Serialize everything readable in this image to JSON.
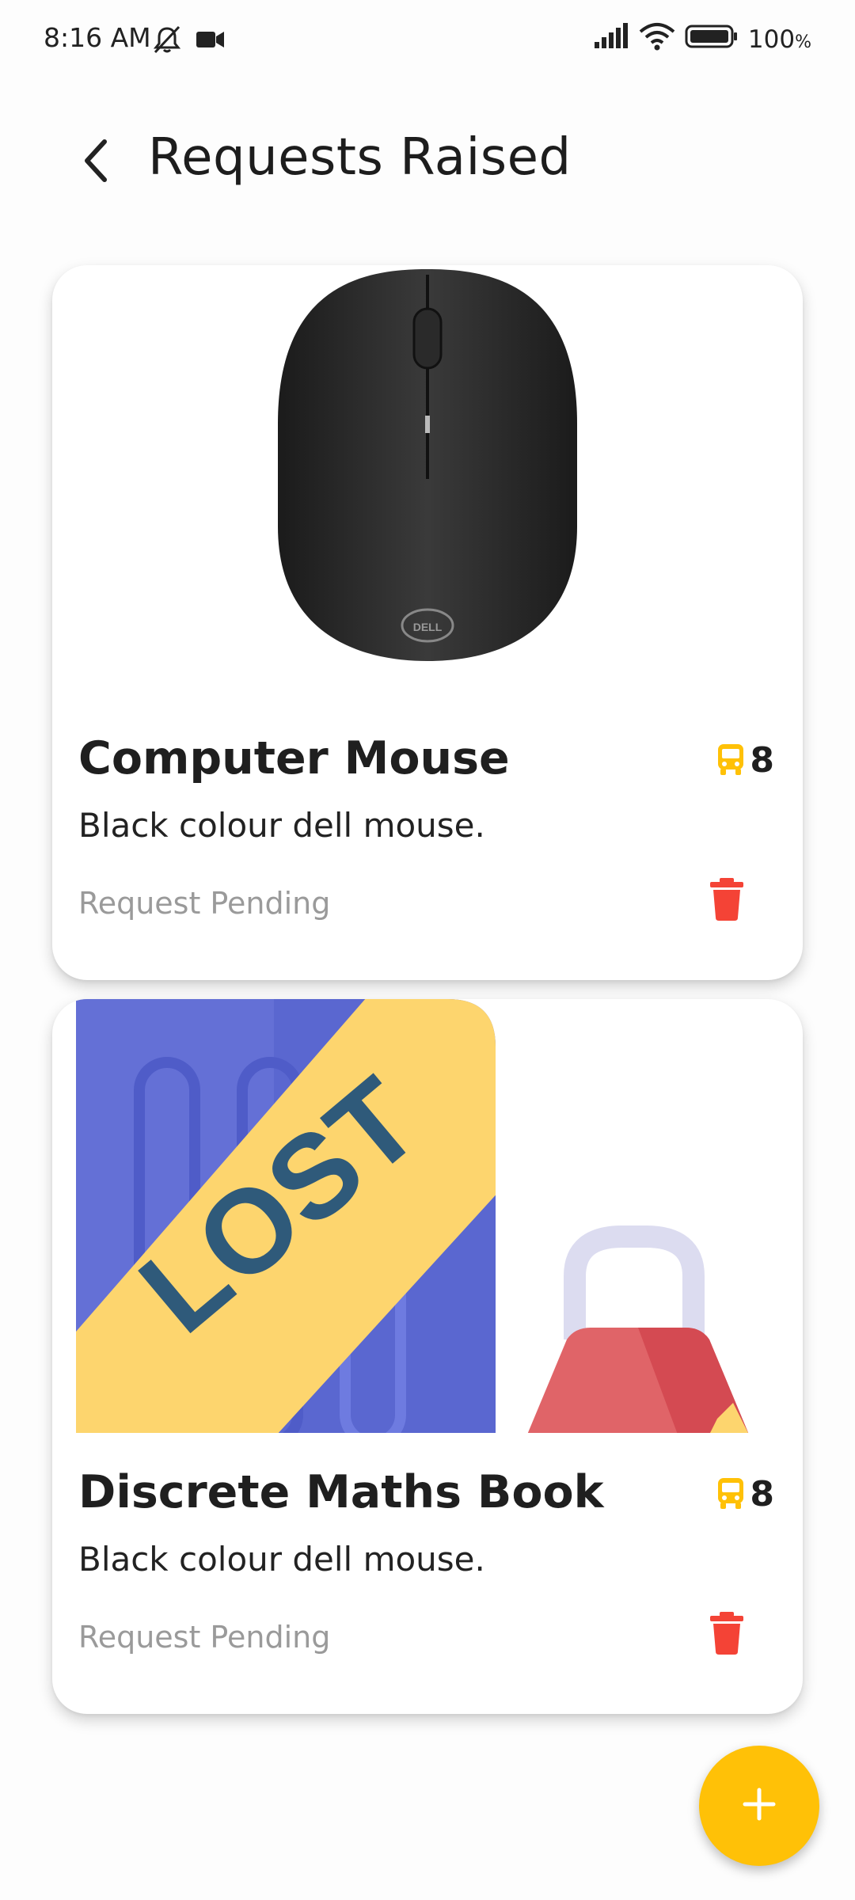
{
  "status_bar": {
    "time": "8:16 AM",
    "battery": "100",
    "battery_unit": "%"
  },
  "header": {
    "title": "Requests Raised"
  },
  "requests": [
    {
      "title": "Computer Mouse",
      "description": "Black colour dell mouse.",
      "seats": "8",
      "status": "Request Pending",
      "image": "computer-mouse-image"
    },
    {
      "title": "Discrete Maths Book",
      "description": "Black colour dell mouse.",
      "seats": "8",
      "status": "Request Pending",
      "image": "lost-item-image"
    }
  ],
  "lost_banner_text": "LOST",
  "mouse_brand_text": "DELL",
  "colors": {
    "accent": "#FFC107",
    "delete": "#F44336",
    "status_text": "#9A9A9A"
  },
  "icons": {
    "back": "back-arrow-icon",
    "seats": "bus-icon",
    "delete": "trash-icon",
    "fab": "plus-icon"
  }
}
